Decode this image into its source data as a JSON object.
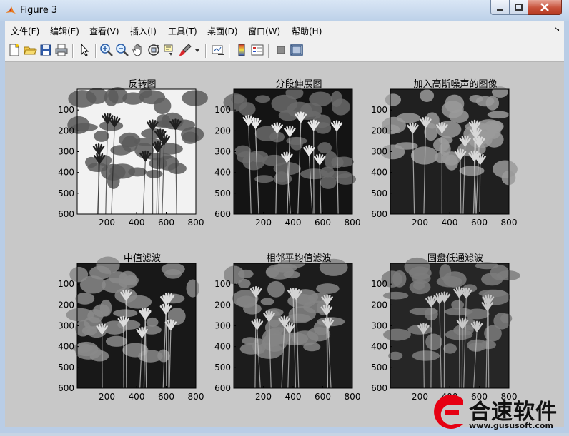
{
  "window": {
    "title": "Figure 3"
  },
  "menu": [
    "文件(F)",
    "编辑(E)",
    "查看(V)",
    "插入(I)",
    "工具(T)",
    "桌面(D)",
    "窗口(W)",
    "帮助(H)"
  ],
  "toolbar_icons": [
    "new-figure-icon",
    "open-file-icon",
    "save-icon",
    "print-icon",
    "pointer-icon",
    "zoom-in-icon",
    "zoom-out-icon",
    "pan-icon",
    "rotate-3d-icon",
    "data-cursor-icon",
    "brush-icon",
    "brush-dropdown-icon",
    "link-plot-icon",
    "colorbar-icon",
    "legend-icon",
    "hide-plot-tools-icon",
    "show-plot-tools-icon"
  ],
  "subplots": [
    {
      "title": "反转图",
      "xticks": [
        "200",
        "400",
        "600",
        "800"
      ],
      "yticks": [
        "100",
        "200",
        "300",
        "400",
        "500",
        "600"
      ]
    },
    {
      "title": "分段伸展图",
      "xticks": [
        "200",
        "400",
        "600",
        "800"
      ],
      "yticks": [
        "100",
        "200",
        "300",
        "400",
        "500",
        "600"
      ]
    },
    {
      "title": "加入高斯噪声的图像",
      "xticks": [
        "200",
        "400",
        "600",
        "800"
      ],
      "yticks": [
        "100",
        "200",
        "300",
        "400",
        "500",
        "600"
      ]
    },
    {
      "title": "中值滤波",
      "xticks": [
        "200",
        "400",
        "600",
        "800"
      ],
      "yticks": [
        "100",
        "200",
        "300",
        "400",
        "500",
        "600"
      ]
    },
    {
      "title": "相邻平均值滤波",
      "xticks": [
        "200",
        "400",
        "600",
        "800"
      ],
      "yticks": [
        "100",
        "200",
        "300",
        "400",
        "500",
        "600"
      ]
    },
    {
      "title": "圆盘低通滤波",
      "xticks": [
        "200",
        "400",
        "600",
        "800"
      ],
      "yticks": [
        "100",
        "200",
        "300",
        "400",
        "500",
        "600"
      ]
    }
  ],
  "watermark": {
    "brand": "合速软件",
    "url": "www.gususoft.com",
    "accent": "#e60012"
  }
}
